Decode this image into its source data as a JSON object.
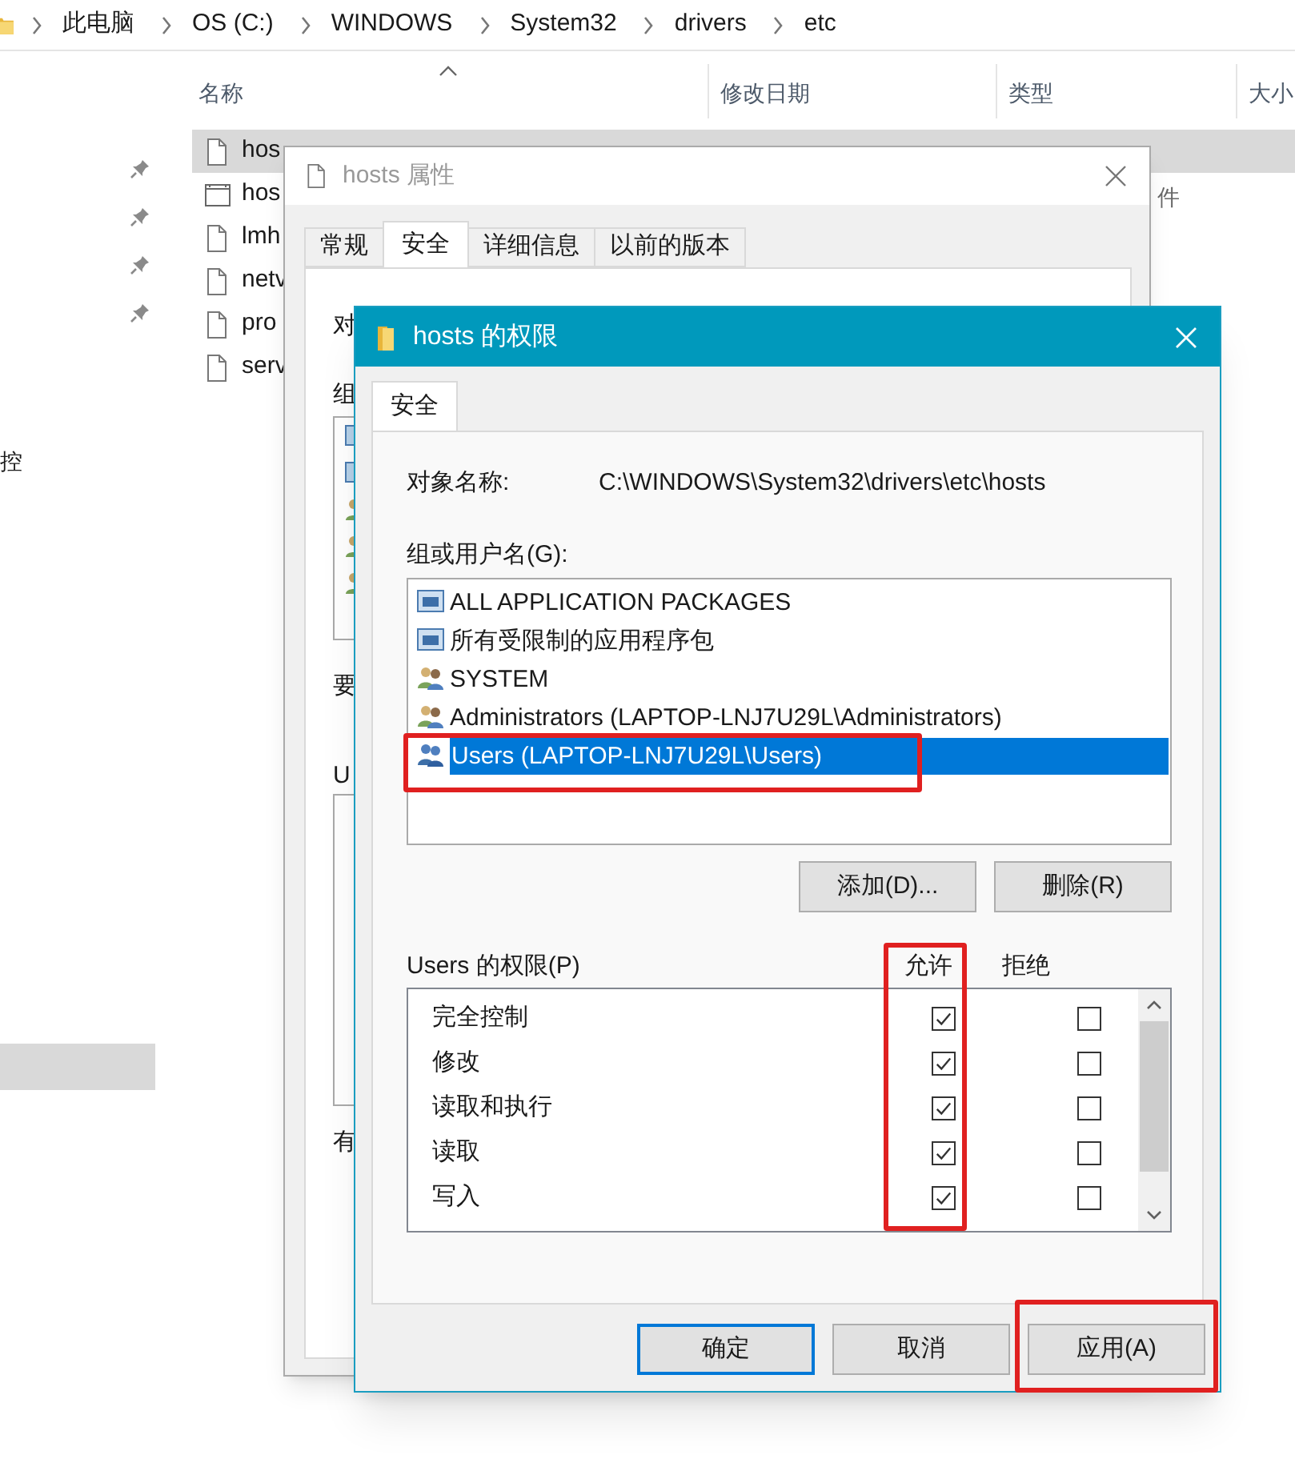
{
  "explorer": {
    "breadcrumb": [
      "此电脑",
      "OS (C:)",
      "WINDOWS",
      "System32",
      "drivers",
      "etc"
    ],
    "columns": [
      "名称",
      "修改日期",
      "类型",
      "大小"
    ],
    "files": [
      {
        "name": "hos",
        "kind": "document",
        "selected": true
      },
      {
        "name": "hos",
        "kind": "window",
        "selected": false,
        "type": "件"
      },
      {
        "name": "lmh",
        "kind": "document",
        "selected": false
      },
      {
        "name": "netv",
        "kind": "document",
        "selected": false
      },
      {
        "name": "pro",
        "kind": "document",
        "selected": false
      },
      {
        "name": "serv",
        "kind": "document",
        "selected": false
      }
    ],
    "sidebar_fragment": "控"
  },
  "properties": {
    "title": "hosts 属性",
    "tabs": [
      {
        "label": "常规",
        "selected": false
      },
      {
        "label": "安全",
        "selected": true
      },
      {
        "label": "详细信息",
        "selected": false
      },
      {
        "label": "以前的版本",
        "selected": false
      }
    ],
    "fragments": [
      "对",
      "组",
      "要",
      "U",
      "有"
    ]
  },
  "permissions": {
    "title": "hosts 的权限",
    "tabs": [
      {
        "label": "安全",
        "selected": true
      }
    ],
    "object_label": "对象名称:",
    "object_name": "C:\\WINDOWS\\System32\\drivers\\etc\\hosts",
    "group_label": "组或用户名(G):",
    "principals": [
      {
        "name": "ALL APPLICATION PACKAGES",
        "kind": "package",
        "selected": false
      },
      {
        "name": "所有受限制的应用程序包",
        "kind": "package",
        "selected": false
      },
      {
        "name": "SYSTEM",
        "kind": "group",
        "selected": false
      },
      {
        "name": "Administrators (LAPTOP-LNJ7U29L\\Administrators)",
        "kind": "group",
        "selected": false
      },
      {
        "name": "Users (LAPTOP-LNJ7U29L\\Users)",
        "kind": "users",
        "selected": true
      }
    ],
    "buttons": [
      "添加(D)...",
      "删除(R)"
    ],
    "permissions_label": "Users 的权限(P)",
    "allow_header": "允许",
    "deny_header": "拒绝",
    "entries": [
      {
        "name": "完全控制",
        "allow": true,
        "deny": false
      },
      {
        "name": "修改",
        "allow": true,
        "deny": false
      },
      {
        "name": "读取和执行",
        "allow": true,
        "deny": false
      },
      {
        "name": "读取",
        "allow": true,
        "deny": false
      },
      {
        "name": "写入",
        "allow": true,
        "deny": false
      }
    ],
    "dialog_buttons": [
      {
        "label": "确定",
        "default": true
      },
      {
        "label": "取消",
        "default": false
      },
      {
        "label": "应用(A)",
        "default": false
      }
    ]
  }
}
